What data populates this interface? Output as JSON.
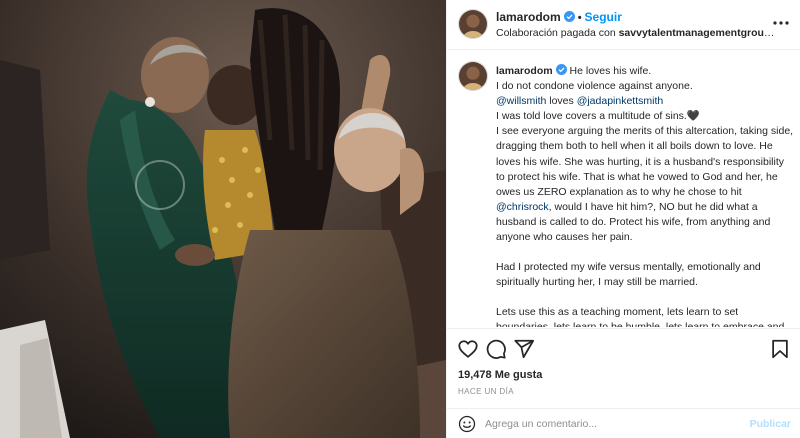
{
  "header": {
    "username": "lamarodom",
    "separator": "•",
    "follow_label": "Seguir",
    "collab_prefix": "Colaboración pagada con ",
    "collab_partner": "savvytalentmanagementgroup, s..."
  },
  "caption": {
    "username": "lamarodom",
    "lines": {
      "l1": "He loves his wife.",
      "l2": "I do not condone violence against anyone.",
      "mention_1": "@willsmith",
      "loves": " loves ",
      "mention_2": "@jadapinkettsmith",
      "l4": "I was told love covers a multitude of sins.🖤",
      "p2_a": "I see everyone arguing the merits of this altercation, taking side, dragging them both to hell when it all boils down to love. He loves his wife. She was hurting, it is a husband's responsibility to protect his wife. That is what he vowed to God and her, he owes us ZERO explanation as to why he chose to hit ",
      "mention_3": "@chrisrock",
      "p2_b": ", would I have hit him?, NO but he did what a husband is called to do. Protect his wife, from anything and anyone who causes her pain.",
      "p3": "Had I protected my wife versus mentally, emotionally and spiritually hurting her, I may still be married.",
      "p4": "Lets use this as a teaching moment, lets learn to set boundaries, lets learn to be humble, lets learn to embrace and forgive each other in the midst of our trials and tribulations versus sitting on a throne of judgement."
    }
  },
  "actions": {
    "likes": "19,478 Me gusta",
    "timestamp": "HACE UN DÍA"
  },
  "comment": {
    "placeholder": "Agrega un comentario...",
    "publish_label": "Publicar"
  },
  "icons": {
    "more": "more-horizontal-icon",
    "like": "heart-icon",
    "comment": "comment-bubble-icon",
    "share": "paper-plane-icon",
    "save": "bookmark-icon",
    "emoji": "smiley-icon",
    "verified": "verified-badge-icon"
  },
  "colors": {
    "accent": "#0095f6",
    "mention": "#00376b",
    "verified": "#3897f0",
    "publish_disabled": "#b2dffc",
    "muted": "#8e8e8e"
  }
}
